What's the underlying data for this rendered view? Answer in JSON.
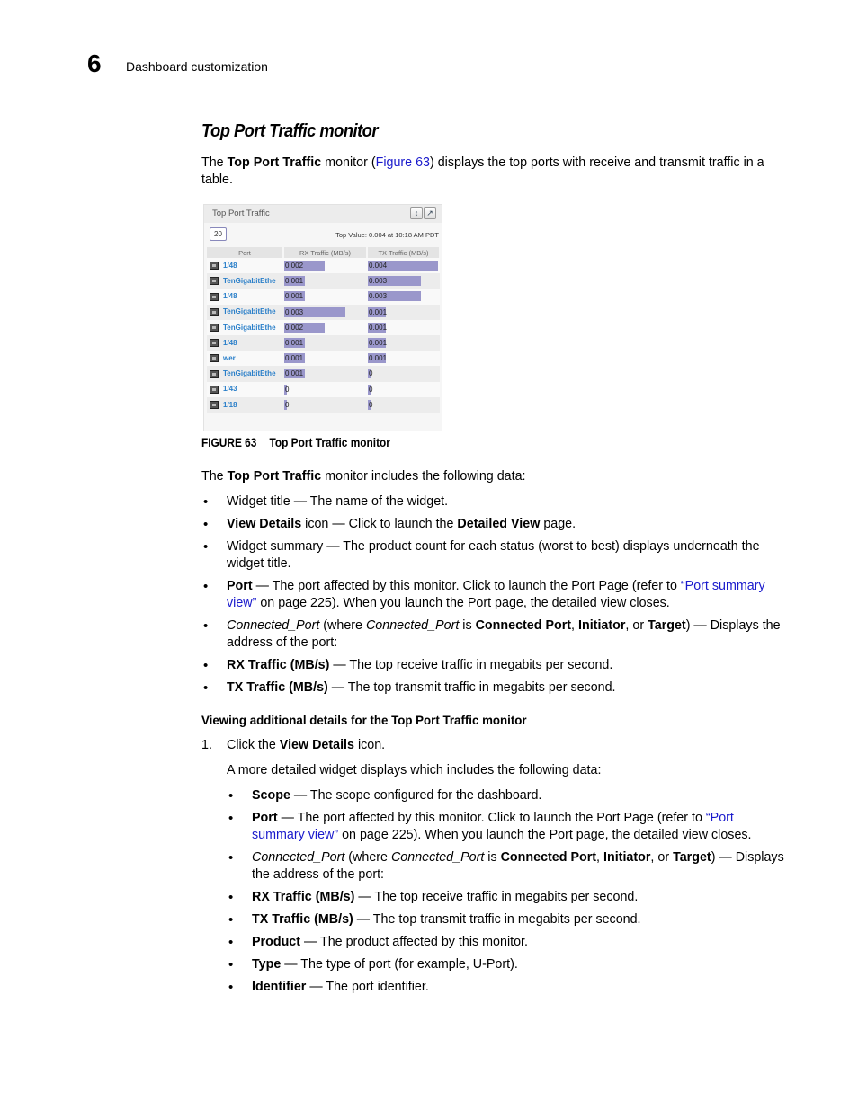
{
  "header": {
    "chapter_number": "6",
    "chapter_title": "Dashboard customization"
  },
  "section_title": "Top Port Traffic monitor",
  "intro": {
    "t1": "The ",
    "b1": "Top Port Traffic",
    "t2": " monitor (",
    "link": "Figure 63",
    "t3": ") displays the top ports with receive and transmit traffic in a table."
  },
  "widget": {
    "title": "Top Port Traffic",
    "icons": [
      "expand-vertical-icon",
      "view-details-icon"
    ],
    "count": "20",
    "top_value": "Top Value: 0.004 at 10:18 AM PDT",
    "columns": [
      "Port",
      "RX Traffic (MB/s)",
      "TX Traffic (MB/s)"
    ],
    "max_value": 0.004,
    "bar_color": "#9a97cb",
    "port_link_color": "#2a7fc9",
    "rows": [
      {
        "port": "1/48",
        "rx": "0.002",
        "tx": "0.004"
      },
      {
        "port": "TenGigabitEthe",
        "rx": "0.001",
        "tx": "0.003"
      },
      {
        "port": "1/48",
        "rx": "0.001",
        "tx": "0.003"
      },
      {
        "port": "TenGigabitEthe",
        "rx": "0.003",
        "tx": "0.001"
      },
      {
        "port": "TenGigabitEthe",
        "rx": "0.002",
        "tx": "0.001"
      },
      {
        "port": "1/48",
        "rx": "0.001",
        "tx": "0.001"
      },
      {
        "port": "wer",
        "rx": "0.001",
        "tx": "0.001"
      },
      {
        "port": "TenGigabitEthe",
        "rx": "0.001",
        "tx": "0"
      },
      {
        "port": "1/43",
        "rx": "0",
        "tx": "0"
      },
      {
        "port": "1/18",
        "rx": "0",
        "tx": "0"
      }
    ]
  },
  "figure": {
    "label": "FIGURE 63",
    "caption": "Top Port Traffic monitor"
  },
  "includes": {
    "t1": "The ",
    "b1": "Top Port Traffic",
    "t2": " monitor includes the following data:"
  },
  "bullets1": {
    "b0": {
      "text": "Widget title — The name of the widget."
    },
    "b1": {
      "bold": "View Details",
      "t1": " icon — Click to launch the ",
      "bold2": "Detailed View",
      "t2": " page."
    },
    "b2": {
      "text": "Widget summary — The product count for each status (worst to best) displays underneath the widget title."
    },
    "b3": {
      "bold": "Port",
      "t1": " — The port affected by this monitor. Click to launch the Port Page (refer to ",
      "link": "“Port summary view”",
      "t2": " on page 225). When you launch the Port page, the detailed view closes."
    },
    "b4": {
      "ital": "Connected_Port",
      "t1": " (where ",
      "ital2": "Connected_Port",
      "t2": " is ",
      "bold1": "Connected Port",
      "t3": ", ",
      "bold2": "Initiator",
      "t4": ", or ",
      "bold3": "Target",
      "t5": ") — Displays the address of the port:"
    },
    "b5": {
      "bold": "RX Traffic (MB/s)",
      "t1": " — The top receive traffic in megabits per second."
    },
    "b6": {
      "bold": "TX Traffic (MB/s)",
      "t1": " — The top transmit traffic in megabits per second."
    }
  },
  "subhead": "Viewing additional details for the Top Port Traffic monitor",
  "step1": {
    "num": "1.",
    "t1": "Click the ",
    "bold": "View Details",
    "t2": " icon."
  },
  "more": "A more detailed widget displays which includes the following data:",
  "bullets2": {
    "b0": {
      "bold": "Scope",
      "t1": " — The scope configured for the dashboard."
    },
    "b1": {
      "bold": "Port",
      "t1": " — The port affected by this monitor. Click to launch the Port Page (refer to ",
      "link": "“Port summary view”",
      "t2": " on page 225). When you launch the Port page, the detailed view closes."
    },
    "b2": {
      "ital": "Connected_Port",
      "t1": " (where ",
      "ital2": "Connected_Port",
      "t2": " is ",
      "bold1": "Connected Port",
      "t3": ", ",
      "bold2": "Initiator",
      "t4": ", or ",
      "bold3": "Target",
      "t5": ") — Displays the address of the port:"
    },
    "b3": {
      "bold": "RX Traffic (MB/s)",
      "t1": " — The top receive traffic in megabits per second."
    },
    "b4": {
      "bold": "TX Traffic (MB/s)",
      "t1": " — The top transmit traffic in megabits per second."
    },
    "b5": {
      "bold": "Product",
      "t1": " — The product affected by this monitor."
    },
    "b6": {
      "bold": "Type",
      "t1": " — The type of port (for example, U-Port)."
    },
    "b7": {
      "bold": "Identifier",
      "t1": " — The port identifier."
    }
  }
}
